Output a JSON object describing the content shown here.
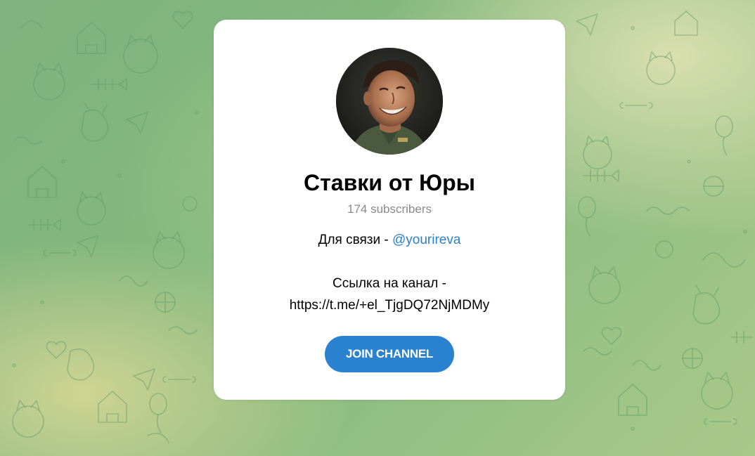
{
  "channel": {
    "name": "Ставки от Юры",
    "subscribers": "174 subscribers",
    "description": {
      "contact_prefix": "Для связи - ",
      "contact_handle": "@yourireva",
      "link_label": "Ссылка на канал -",
      "link_url": "https://t.me/+el_TjgDQ72NjMDMy"
    }
  },
  "actions": {
    "join_label": "JOIN CHANNEL"
  },
  "colors": {
    "accent": "#2a82d0",
    "link": "#2a7fce",
    "background": "#84b97e",
    "card": "#ffffff"
  }
}
